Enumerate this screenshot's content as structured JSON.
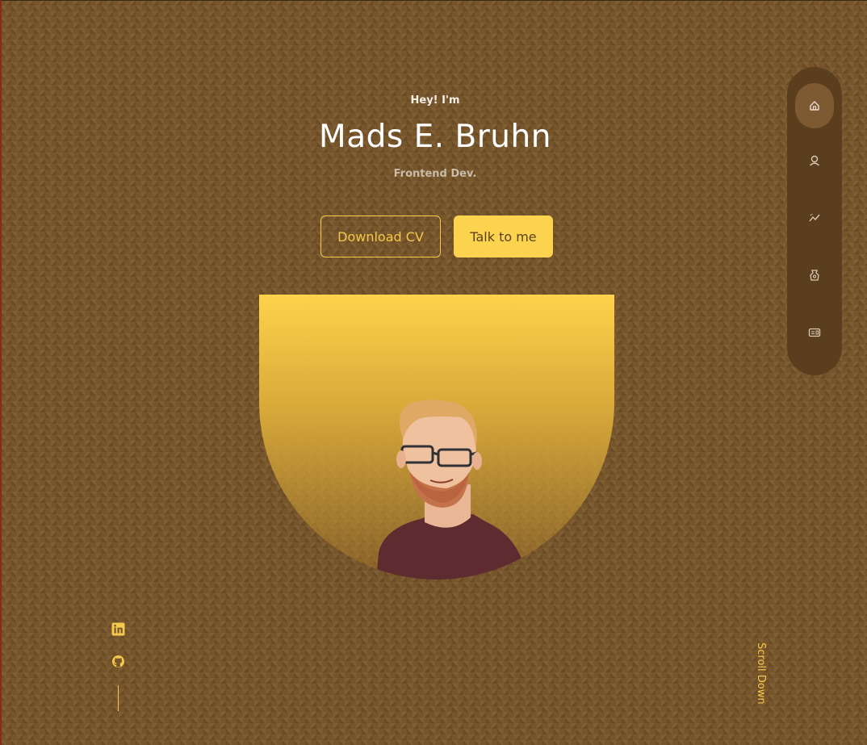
{
  "hero": {
    "greeting": "Hey! I'm",
    "name": "Mads E. Bruhn",
    "role": "Frontend Dev."
  },
  "buttons": {
    "download_cv": "Download CV",
    "talk": "Talk to me"
  },
  "nav": {
    "items": [
      {
        "icon": "home-icon",
        "active": true
      },
      {
        "icon": "user-icon",
        "active": false
      },
      {
        "icon": "experience-icon",
        "active": false
      },
      {
        "icon": "services-icon",
        "active": false
      },
      {
        "icon": "contact-icon",
        "active": false
      }
    ]
  },
  "social": {
    "items": [
      {
        "icon": "linkedin-icon"
      },
      {
        "icon": "github-icon"
      }
    ]
  },
  "scroll": {
    "label": "Scroll Down"
  },
  "colors": {
    "background": "#77552a",
    "accent": "#fcd34f",
    "nav_bg": "#5b3e1e"
  }
}
